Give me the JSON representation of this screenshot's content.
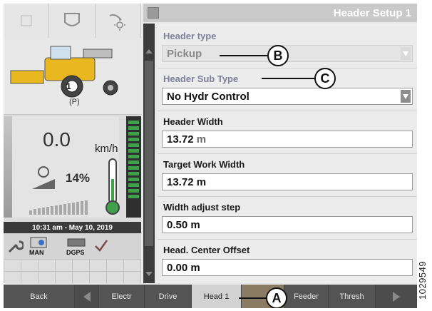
{
  "header": {
    "title": "Header Setup 1"
  },
  "fields": {
    "header_type": {
      "label": "Header type",
      "value": "Pickup",
      "enabled": false
    },
    "header_sub_type": {
      "label": "Header Sub Type",
      "value": "No Hydr Control",
      "enabled": true
    },
    "header_width": {
      "label": "Header Width",
      "value": "13.72",
      "unit": "m"
    },
    "target_work_width": {
      "label": "Target Work Width",
      "value": "13.72",
      "unit": "m"
    },
    "width_adjust_step": {
      "label": "Width adjust step",
      "value": "0.50",
      "unit": "m"
    },
    "head_center_offset": {
      "label": "Head. Center Offset",
      "value": "0.00",
      "unit": "m"
    }
  },
  "status": {
    "park_indicator": "(P)",
    "gear": "1",
    "speed_value": "0.0",
    "speed_unit": "km/h",
    "load_percent": "14%",
    "clock": "10:31 am - May 10, 2019",
    "badges": {
      "man": "MAN",
      "dgps": "DGPS"
    }
  },
  "tabs": [
    "Back",
    "Electr",
    "Drive",
    "Head 1",
    "Feeder",
    "Thresh"
  ],
  "active_tab": "Head 1",
  "callouts": {
    "a": "A",
    "b": "B",
    "c": "C"
  },
  "reference_number": "1029549",
  "colors": {
    "accent_green": "#3fa24a",
    "machine_yellow": "#e9b820"
  },
  "icons": [
    "wrench-icon",
    "combine-icon",
    "thermometer-icon",
    "engine-load-icon",
    "fan-icon",
    "check-icon"
  ]
}
